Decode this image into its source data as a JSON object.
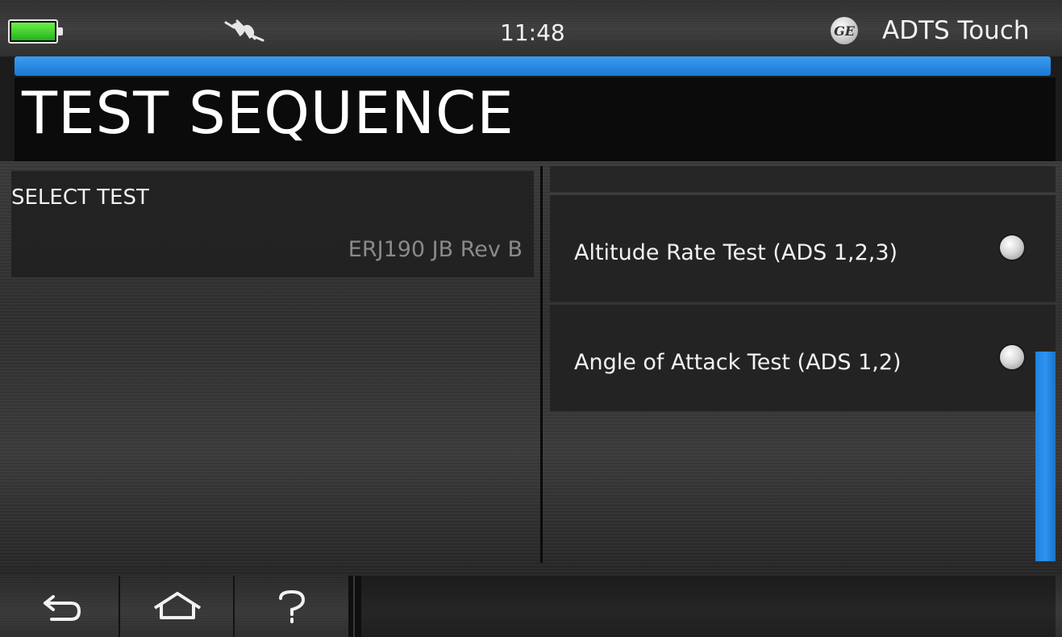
{
  "status_bar": {
    "time": "11:48",
    "app_name": "ADTS Touch",
    "logo_text": "GE",
    "battery_icon": "battery-full-icon",
    "connection_icon": "disconnected-plug-icon"
  },
  "header": {
    "title": "TEST SEQUENCE"
  },
  "select_test": {
    "label": "SELECT TEST",
    "value": "ERJ190 JB Rev B"
  },
  "tests": [
    {
      "label": "Altitude Rate Test (ADS 1,2,3)",
      "selected": false
    },
    {
      "label": "Angle of Attack Test (ADS 1,2)",
      "selected": false
    }
  ],
  "nav": {
    "back_icon": "back-arrow-icon",
    "home_icon": "home-icon",
    "help_icon": "help-question-icon"
  },
  "colors": {
    "accent": "#1a78d2",
    "battery": "#3cc92a",
    "background": "#2f2f2f"
  }
}
